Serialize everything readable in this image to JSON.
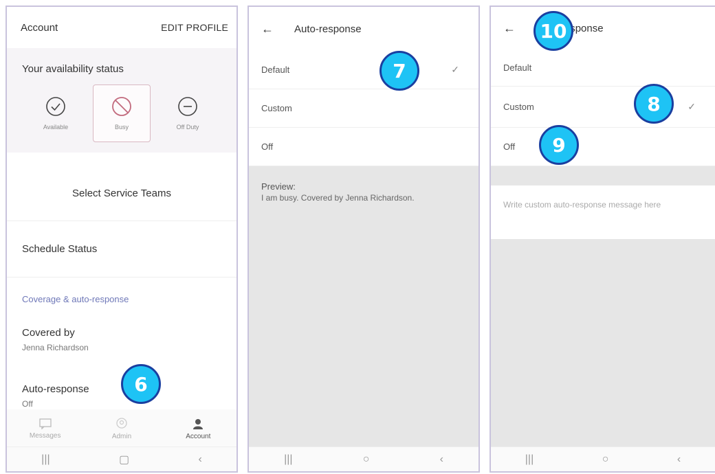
{
  "screen1": {
    "header_title": "Account",
    "edit_profile": "EDIT PROFILE",
    "availability_title": "Your availability status",
    "statuses": [
      {
        "label": "Available",
        "icon": "check-circle-icon"
      },
      {
        "label": "Busy",
        "icon": "prohibited-circle-icon",
        "selected": true
      },
      {
        "label": "Off Duty",
        "icon": "minus-circle-icon"
      }
    ],
    "select_teams": "Select Service Teams",
    "schedule_status": "Schedule Status",
    "coverage_section": "Coverage & auto-response",
    "covered_by_label": "Covered by",
    "covered_by_value": "Jenna Richardson",
    "auto_response_label": "Auto-response",
    "auto_response_value": "Off",
    "nav": [
      {
        "label": "Messages",
        "icon": "chat-icon"
      },
      {
        "label": "Admin",
        "icon": "admin-icon"
      },
      {
        "label": "Account",
        "icon": "account-icon"
      }
    ]
  },
  "screen2": {
    "title": "Auto-response",
    "options": [
      "Default",
      "Custom",
      "Off"
    ],
    "selected": "Default",
    "preview_label": "Preview:",
    "preview_text": "I am busy. Covered by Jenna Richardson."
  },
  "screen3": {
    "title": "Auto-response",
    "options": [
      "Default",
      "Custom",
      "Off"
    ],
    "selected": "Custom",
    "custom_placeholder": "Write custom auto-response message here"
  },
  "badges": [
    "6",
    "7",
    "8",
    "9",
    "10"
  ],
  "colors": {
    "badge_fill": "#1ec3f5",
    "badge_border": "#1a3fa0",
    "section_blue": "#6f78b8"
  }
}
